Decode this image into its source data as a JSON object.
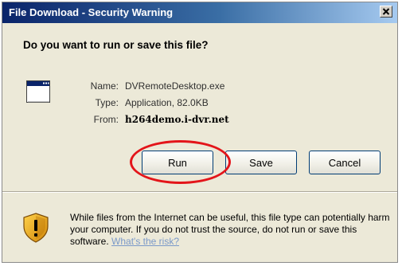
{
  "window": {
    "title": "File Download - Security Warning",
    "close_label": "×"
  },
  "question": "Do you want to run or save this file?",
  "file": {
    "name_label": "Name:",
    "name_value": "DVRemoteDesktop.exe",
    "type_label": "Type:",
    "type_value": "Application, 82.0KB",
    "from_label": "From:",
    "from_value": "h264demo.i-dvr.net",
    "icon": "application-window-icon"
  },
  "buttons": {
    "run": "Run",
    "save": "Save",
    "cancel": "Cancel"
  },
  "warning": {
    "icon": "shield-warning-icon",
    "text": "While files from the Internet can be useful, this file type can potentially harm your computer. If you do not trust the source, do not run or save this software.",
    "link": "What's the risk?"
  },
  "colors": {
    "title_bar_start": "#0a246a",
    "title_bar_end": "#a6caf0",
    "dialog_bg": "#ece9d8",
    "highlight_ring": "#e3151a",
    "link": "#7a99c9"
  }
}
